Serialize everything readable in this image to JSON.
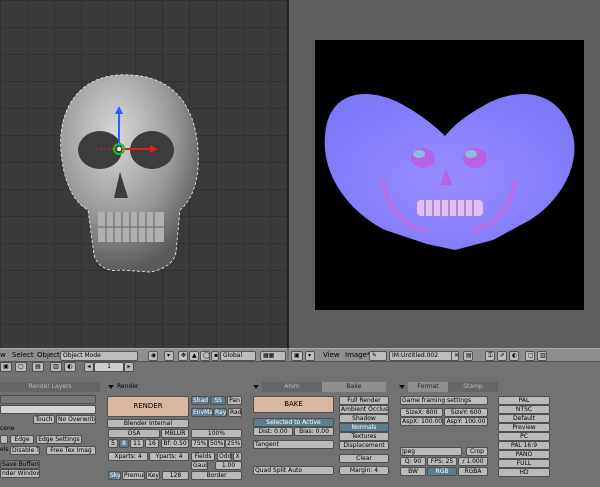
{
  "viewport_header": {
    "view": "w",
    "select": "Select",
    "object": "Object",
    "mode": "Object Mode",
    "orientation": "Global"
  },
  "uv_header": {
    "view": "View",
    "image": "Image*",
    "image_name": "IM:Untitled.002"
  },
  "status": {
    "page": "1"
  },
  "render_layers": {
    "tab": "Render Layers",
    "touch": "Touch",
    "no_overwrite": "No Overwrite",
    "scene": "cene",
    "edge": "Edge",
    "edge_settings": "Edge Settings",
    "els": "els",
    "disable_tex": "Disable Te",
    "free_tex": "Free Tex Imag",
    "save_buffers": "Save Buffers",
    "render_window": "nder Window"
  },
  "render_panel": {
    "title": "Render",
    "render_button": "RENDER",
    "engine": "Blender Internal",
    "shadow": "Shado",
    "ss": "SS",
    "pan": "Pan",
    "envmap": "EnvMa",
    "ray": "Ray",
    "radio": "Radi",
    "osa": "OSA",
    "mblur": "MBLUR",
    "pct100": "100%",
    "osa_values": [
      "5",
      "8",
      "11",
      "16"
    ],
    "bf": "Bf: 0.50",
    "pct_options": [
      "75%",
      "50%",
      "25%"
    ],
    "xparts": "Xparts: 4",
    "yparts": "Yparts: 4",
    "fields": "Fields",
    "odd": "Odd",
    "x": "X",
    "gaus": "Gaus",
    "gaus_value": "1.00",
    "sky": "Sky",
    "premul": "Premul",
    "key": "Key",
    "size": "128",
    "border": "Border"
  },
  "bake_panel": {
    "anim_tab": "Anim",
    "bake_tab": "Bake",
    "bake_button": "BAKE",
    "selected_to_active": "Selected to Active",
    "dist": "Dist: 0.00",
    "bias": "Bias: 0.00",
    "space": "Tangent",
    "quad": "Quad Split Auto",
    "full_render": "Full Render",
    "ambient_occlusion": "Ambient Occlusi",
    "shadow": "Shadow",
    "normals": "Normals",
    "textures": "Textures",
    "displacement": "Displacement",
    "clear": "Clear",
    "margin": "Margin: 4"
  },
  "format_panel": {
    "format_tab": "Format",
    "stamp_tab": "Stamp",
    "game_framing": "Game framing settings",
    "sizex": "SizeX: 800",
    "sizey": "SizeY: 600",
    "aspx": "AspX: 100.00",
    "aspy": "AspY: 100.00",
    "file_type": "Jpeg",
    "crop": "Crop",
    "quality": "Q: 90",
    "fps": "FPS: 25",
    "fps_base": "/ 1.000",
    "bw": "BW",
    "rgb": "RGB",
    "rgba": "RGBA",
    "presets": [
      "PAL",
      "NTSC",
      "Default",
      "Preview",
      "PC",
      "PAL 16:9",
      "PANO",
      "FULL",
      "HD"
    ]
  },
  "colors": {
    "viewport_bg": "#3a3a3a",
    "normal_map_blue": "#8080ff",
    "active_button": "#5d7d91",
    "render_button": "#d7b7a0"
  }
}
